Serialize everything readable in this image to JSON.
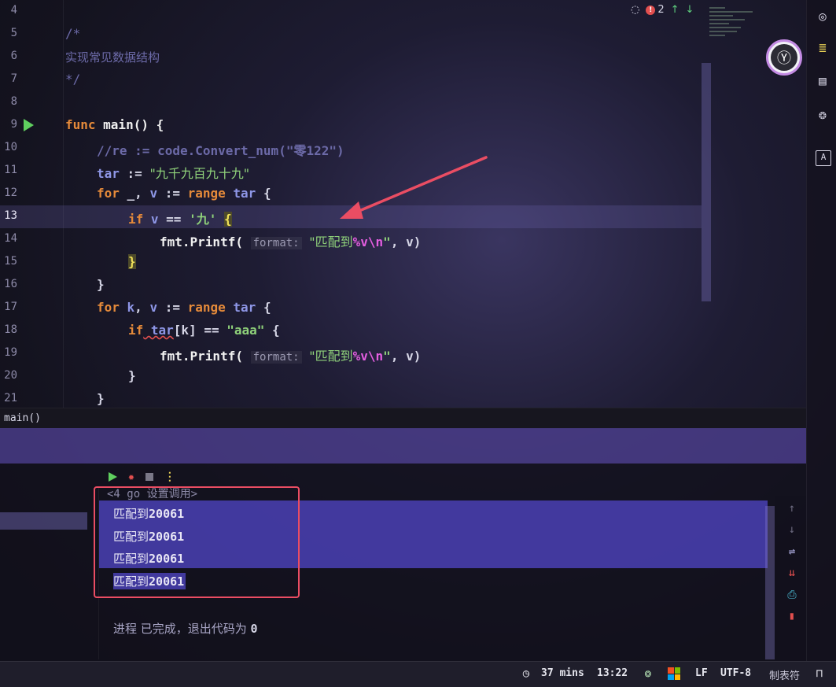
{
  "editor": {
    "line_numbers": [
      "4",
      "5",
      "6",
      "7",
      "8",
      "9",
      "10",
      "11",
      "12",
      "13",
      "14",
      "15",
      "16",
      "17",
      "18",
      "19",
      "20",
      "21"
    ],
    "comment_open": "/*",
    "comment_text": "实现常见数据结构",
    "comment_close": "*/",
    "func_kw": "func",
    "func_sig": " main() {",
    "l10_comment": "//re := code.Convert_num(\"零122\")",
    "l11_var": "tar",
    "l11_op": " := ",
    "l11_str": "\"九千九百九十九\"",
    "l12_for": "for",
    "l12_mid": " _, ",
    "l12_v": "v",
    "l12_op": " := ",
    "l12_range": "range",
    "l12_tar": " tar",
    "l12_brace": " {",
    "l13_if": "if",
    "l13_v": " v",
    "l13_op": " == ",
    "l13_rune": "'九'",
    "l13_brace": "{",
    "l14_call": "fmt.Printf(",
    "l14_hint": "format:",
    "l14_str_a": "\"匹配到",
    "l14_fmt": "%v\\n",
    "l14_str_b": "\"",
    "l14_args": ", v)",
    "l15_brace": "}",
    "l16_brace": "}",
    "l17_for": "for",
    "l17_k": " k",
    "l17_mid": ", ",
    "l17_v": "v",
    "l17_op": " := ",
    "l17_range": "range",
    "l17_tar": " tar",
    "l17_brace": " {",
    "l18_if": "if",
    "l18_tar": " tar",
    "l18_idx": "[k]",
    "l18_op": " == ",
    "l18_str": "\"aaa\"",
    "l18_brace": " {",
    "l19_call": "fmt.Printf(",
    "l19_hint": "format:",
    "l19_str_a": "\"匹配到",
    "l19_fmt": "%v\\n",
    "l19_str_b": "\"",
    "l19_args": ", v)",
    "l20_brace": "}",
    "l21_brace": "}"
  },
  "top_status": {
    "error_count": "2",
    "up_arrow": "↑",
    "down_arrow": "↓"
  },
  "breadcrumb": {
    "label": "main()"
  },
  "console": {
    "cmd_partial": "<4 go 设置调用>",
    "lines": [
      {
        "prefix": "匹配到",
        "value": "20061"
      },
      {
        "prefix": "匹配到",
        "value": "20061"
      },
      {
        "prefix": "匹配到",
        "value": "20061"
      },
      {
        "prefix": "匹配到",
        "value": "20061"
      }
    ],
    "exit_prefix": "进程 已完成，退出代码为 ",
    "exit_code": "0"
  },
  "statusbar": {
    "time_tracked": "37 mins",
    "position": "13:22",
    "line_ending": "LF",
    "encoding": "UTF-8",
    "indent": "制表符"
  },
  "colors": {
    "accent_purple": "#4e44be",
    "annotation_red": "#ea4d63",
    "keyword": "#e58a3a",
    "string": "#8fd17a",
    "run_green": "#5fcf5f"
  },
  "icons": {
    "right_bar": [
      "ai-assistant-icon",
      "database-icon",
      "notifications-icon",
      "copilot-icon",
      "translate-icon"
    ],
    "console_side": [
      "scroll-up-icon",
      "scroll-down-icon",
      "soft-wrap-icon",
      "scroll-to-end-icon",
      "print-icon",
      "trash-icon"
    ]
  }
}
